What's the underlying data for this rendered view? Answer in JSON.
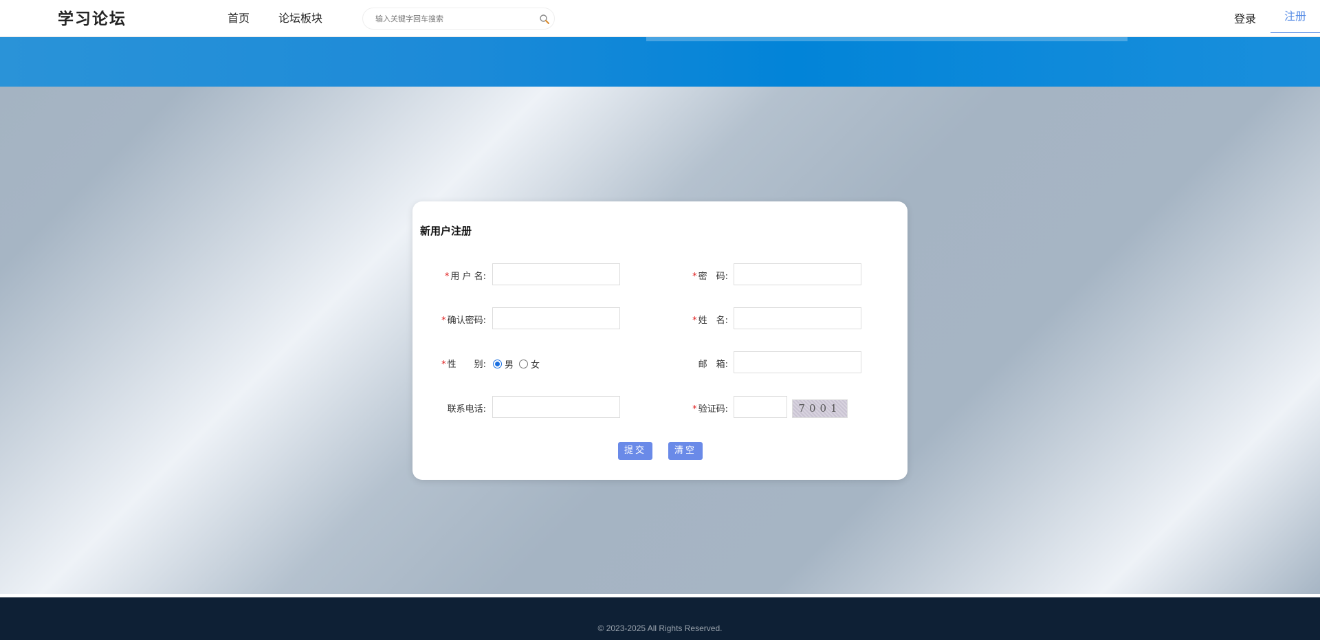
{
  "header": {
    "logo": "学习论坛",
    "nav": {
      "home": "首页",
      "forum": "论坛板块"
    },
    "search": {
      "placeholder": "输入关键字回车搜索"
    },
    "login": "登录",
    "register": "注册"
  },
  "form": {
    "title": "新用户注册",
    "username_label": "用 户 名:",
    "password_label": "密　码:",
    "confirm_label": "确认密码:",
    "name_label": "姓　名:",
    "gender_label": "性　　别:",
    "gender_options": {
      "male": "男",
      "female": "女"
    },
    "gender_selected": "男",
    "email_label": "邮　箱:",
    "phone_label": "联系电话:",
    "captcha_label": "验证码:",
    "captcha_text": "7001",
    "required_mark": "*",
    "submit": "提交",
    "clear": "清空"
  },
  "footer": {
    "copyright": "© 2023-2025 All Rights Reserved."
  },
  "colors": {
    "accent": "#6a8ae8",
    "banner": "#1c8ad8",
    "footer": "#0e2035",
    "required": "#e02020"
  }
}
